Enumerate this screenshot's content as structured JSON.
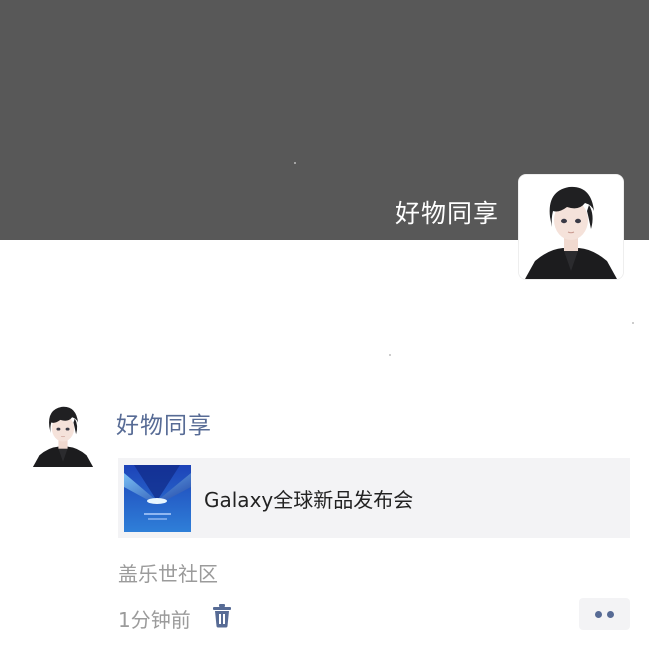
{
  "cover": {
    "name": "好物同享",
    "background_color": "#585858",
    "avatar_icon": "anime-boy-avatar"
  },
  "post": {
    "author": "好物同享",
    "author_color": "#576b95",
    "avatar_icon": "anime-boy-avatar",
    "link": {
      "title": "Galaxy全球新品发布会",
      "thumbnail_icon": "galaxy-event-thumbnail"
    },
    "source": "盖乐世社区",
    "time": "1分钟前",
    "delete_icon": "trash-icon",
    "more_icon": "more-dots-icon"
  }
}
